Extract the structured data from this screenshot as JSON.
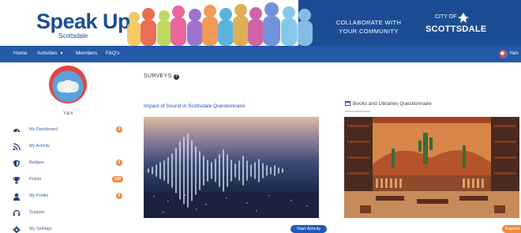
{
  "banner": {
    "logo_title": "Speak Up",
    "logo_sub": "Scottsdale",
    "collab_line1": "COLLABORATE WITH",
    "collab_line2": "YOUR COMMUNITY",
    "city_small": "CITY OF",
    "city_name": "SCOTTSDALE",
    "colors": {
      "blue": "#1c4d94",
      "navbar": "#2359a8"
    }
  },
  "nav": {
    "items": [
      {
        "label": "Home"
      },
      {
        "label": "Activities"
      },
      {
        "label": "Members"
      },
      {
        "label": "FAQ's"
      }
    ],
    "user_name": "Yani"
  },
  "sidebar": {
    "profile_name": "Yani",
    "items": [
      {
        "label": "My Dashboard",
        "icon": "dashboard-gauge-icon",
        "badge": "0"
      },
      {
        "label": "My Activity",
        "icon": "rss-feed-icon",
        "badge": ""
      },
      {
        "label": "Badges",
        "icon": "shield-icon",
        "badge": "0"
      },
      {
        "label": "Points",
        "icon": "trophy-icon",
        "badge": "100"
      },
      {
        "label": "My Profile",
        "icon": "user-icon",
        "badge": "0"
      },
      {
        "label": "Support",
        "icon": "headset-icon",
        "badge": ""
      },
      {
        "label": "My Settings",
        "icon": "gear-icon",
        "badge": ""
      }
    ],
    "badge_color": "#ee8a3d"
  },
  "main": {
    "section_title": "SURVEYS",
    "cards": [
      {
        "title": "Impact of Sound in Scottsdale Questionnaire",
        "button": "Start Activity",
        "image": "sound-waveform-city-image"
      },
      {
        "title": "Books and Libraries Questionnaire",
        "button": "Explore",
        "image": "library-interior-image"
      }
    ],
    "accent": "#1f58b8"
  }
}
